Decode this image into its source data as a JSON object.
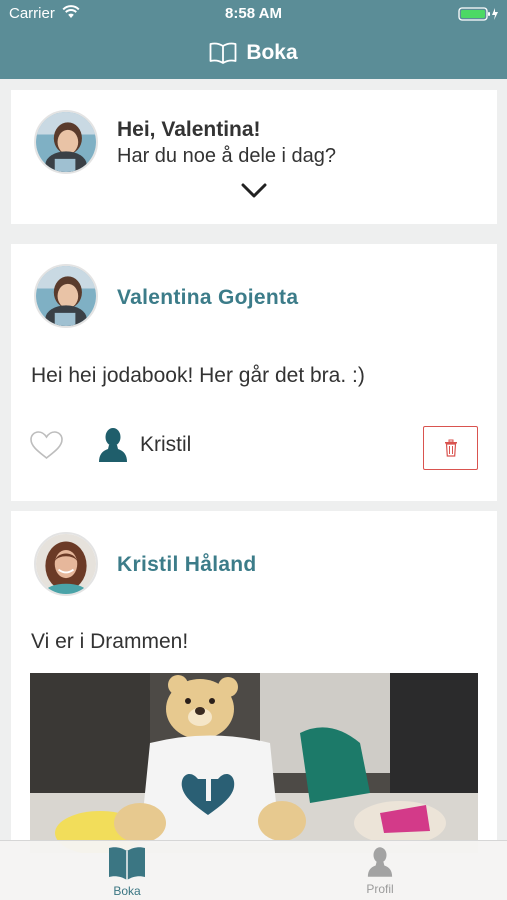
{
  "status_bar": {
    "carrier": "Carrier",
    "time": "8:58 AM"
  },
  "nav": {
    "title": "Boka"
  },
  "composer": {
    "greeting": "Hei, Valentina!",
    "prompt": "Har du noe å dele i dag?"
  },
  "posts": [
    {
      "author": "Valentina Gojenta",
      "text": "Hei hei jodabook! Her går det bra. :)",
      "liker": "Kristil"
    },
    {
      "author": "Kristil Håland",
      "text": "Vi er i Drammen!"
    }
  ],
  "tabbar": {
    "tabs": [
      {
        "label": "Boka",
        "icon": "book-icon"
      },
      {
        "label": "Profil",
        "icon": "person-icon"
      }
    ]
  },
  "colors": {
    "header": "#5b8d97",
    "accent": "#3c7c89",
    "delete": "#d9534f",
    "person_icon": "#1f5e6b"
  }
}
